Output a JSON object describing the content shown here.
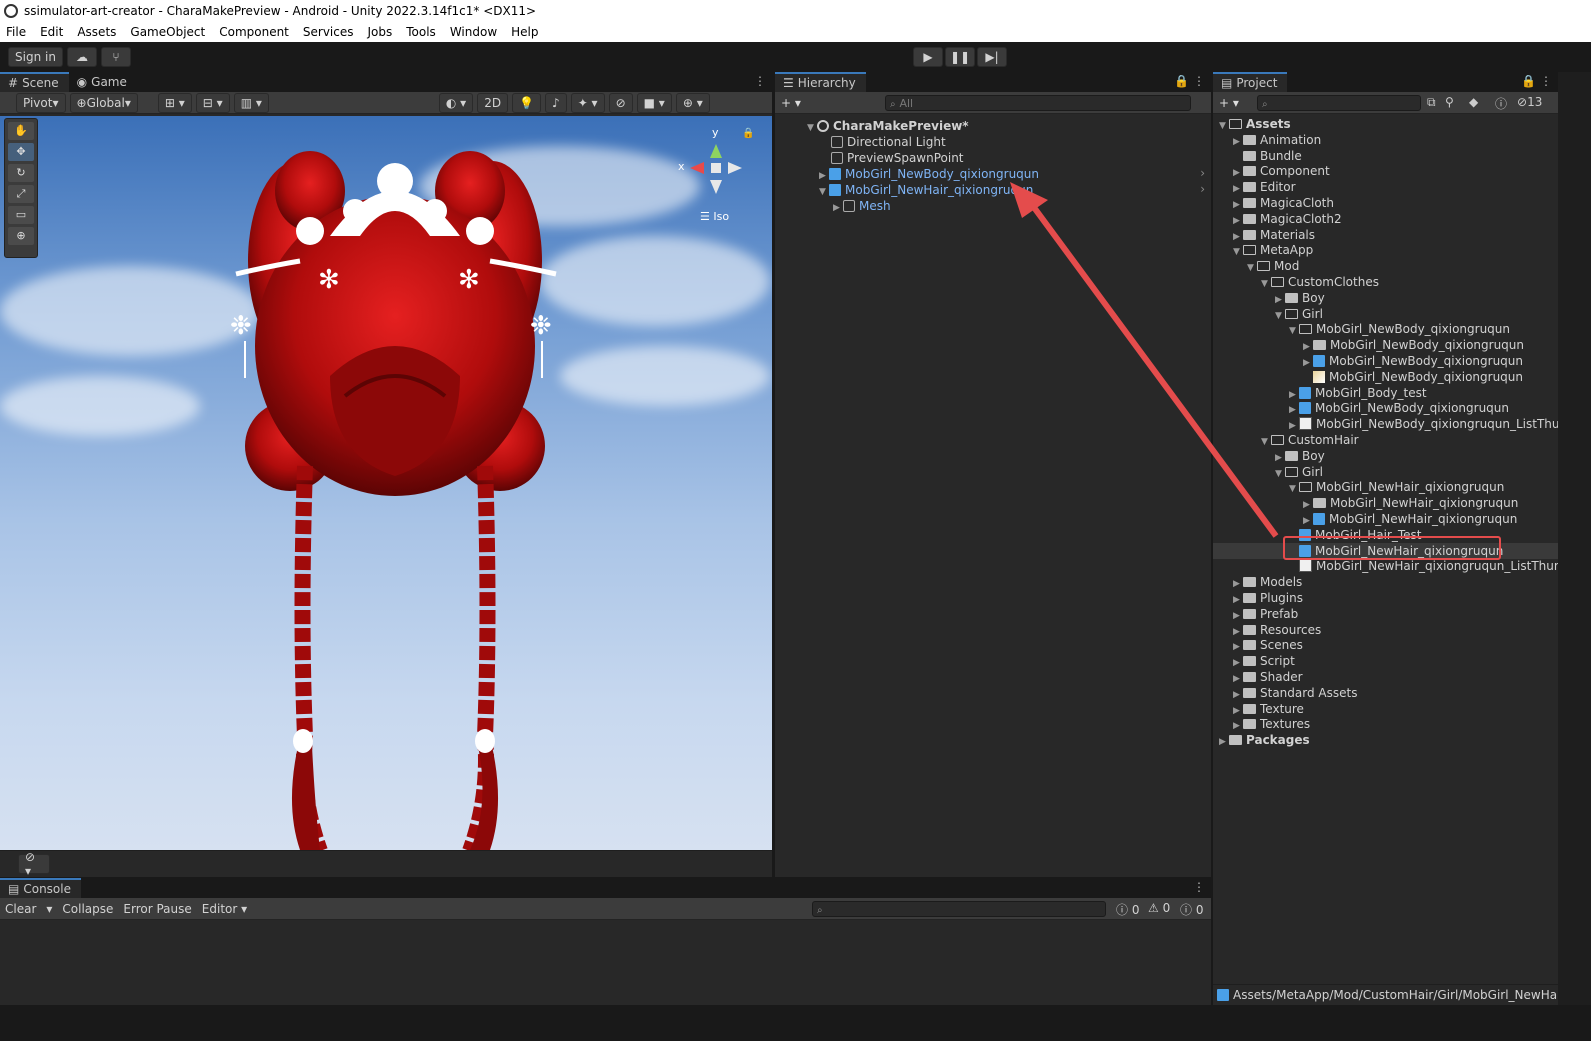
{
  "window": {
    "title": "ssimulator-art-creator - CharaMakePreview - Android - Unity 2022.3.14f1c1* <DX11>"
  },
  "menu": [
    "File",
    "Edit",
    "Assets",
    "GameObject",
    "Component",
    "Services",
    "Jobs",
    "Tools",
    "Window",
    "Help"
  ],
  "toolbar": {
    "sign_in": "Sign in"
  },
  "scene": {
    "tabs": [
      "Scene",
      "Game"
    ],
    "pivot": "Pivot",
    "global": "Global",
    "mode_2d": "2D",
    "gizmo_y": "y",
    "gizmo_x": "x",
    "iso": "Iso"
  },
  "hierarchy": {
    "tab": "Hierarchy",
    "search_placeholder": "All",
    "items": [
      {
        "label": "CharaMakePreview*",
        "kind": "scene"
      },
      {
        "label": "Directional Light",
        "kind": "go"
      },
      {
        "label": "PreviewSpawnPoint",
        "kind": "go"
      },
      {
        "label": "MobGirl_NewBody_qixiongruqun",
        "kind": "prefab"
      },
      {
        "label": "MobGirl_NewHair_qixiongruqun",
        "kind": "prefab"
      },
      {
        "label": "Mesh",
        "kind": "go"
      }
    ]
  },
  "project": {
    "tab": "Project",
    "hidden_count": "13",
    "tree": [
      {
        "label": "Assets",
        "depth": 0,
        "kind": "folder-open",
        "arrow": "down",
        "bold": true
      },
      {
        "label": "Animation",
        "depth": 1,
        "kind": "folder",
        "arrow": "right"
      },
      {
        "label": "Bundle",
        "depth": 1,
        "kind": "folder",
        "arrow": ""
      },
      {
        "label": "Component",
        "depth": 1,
        "kind": "folder",
        "arrow": "right"
      },
      {
        "label": "Editor",
        "depth": 1,
        "kind": "folder",
        "arrow": "right"
      },
      {
        "label": "MagicaCloth",
        "depth": 1,
        "kind": "folder",
        "arrow": "right"
      },
      {
        "label": "MagicaCloth2",
        "depth": 1,
        "kind": "folder",
        "arrow": "right"
      },
      {
        "label": "Materials",
        "depth": 1,
        "kind": "folder",
        "arrow": "right"
      },
      {
        "label": "MetaApp",
        "depth": 1,
        "kind": "folder-open",
        "arrow": "down"
      },
      {
        "label": "Mod",
        "depth": 2,
        "kind": "folder-open",
        "arrow": "down"
      },
      {
        "label": "CustomClothes",
        "depth": 3,
        "kind": "folder-open",
        "arrow": "down"
      },
      {
        "label": "Boy",
        "depth": 4,
        "kind": "folder",
        "arrow": "right"
      },
      {
        "label": "Girl",
        "depth": 4,
        "kind": "folder-open",
        "arrow": "down"
      },
      {
        "label": "MobGirl_NewBody_qixiongruqun",
        "depth": 5,
        "kind": "folder-open",
        "arrow": "down"
      },
      {
        "label": "MobGirl_NewBody_qixiongruqun",
        "depth": 6,
        "kind": "folder",
        "arrow": "right"
      },
      {
        "label": "MobGirl_NewBody_qixiongruqun",
        "depth": 6,
        "kind": "prefab",
        "arrow": "right"
      },
      {
        "label": "MobGirl_NewBody_qixiongruqun",
        "depth": 6,
        "kind": "image",
        "arrow": ""
      },
      {
        "label": "MobGirl_Body_test",
        "depth": 5,
        "kind": "prefab",
        "arrow": "right"
      },
      {
        "label": "MobGirl_NewBody_qixiongruqun",
        "depth": 5,
        "kind": "prefab",
        "arrow": "right"
      },
      {
        "label": "MobGirl_NewBody_qixiongruqun_ListThumb",
        "depth": 5,
        "kind": "thumb",
        "arrow": "right"
      },
      {
        "label": "CustomHair",
        "depth": 3,
        "kind": "folder-open",
        "arrow": "down"
      },
      {
        "label": "Boy",
        "depth": 4,
        "kind": "folder",
        "arrow": "right"
      },
      {
        "label": "Girl",
        "depth": 4,
        "kind": "folder-open",
        "arrow": "down"
      },
      {
        "label": "MobGirl_NewHair_qixiongruqun",
        "depth": 5,
        "kind": "folder-open",
        "arrow": "down"
      },
      {
        "label": "MobGirl_NewHair_qixiongruqun",
        "depth": 6,
        "kind": "folder",
        "arrow": "right"
      },
      {
        "label": "MobGirl_NewHair_qixiongruqun",
        "depth": 6,
        "kind": "prefab",
        "arrow": "right"
      },
      {
        "label": "MobGirl_Hair_Test",
        "depth": 5,
        "kind": "prefab",
        "arrow": ""
      },
      {
        "label": "MobGirl_NewHair_qixiongruqun",
        "depth": 5,
        "kind": "prefab",
        "arrow": "",
        "selected": true
      },
      {
        "label": "MobGirl_NewHair_qixiongruqun_ListThumb",
        "depth": 5,
        "kind": "thumb",
        "arrow": ""
      },
      {
        "label": "Models",
        "depth": 1,
        "kind": "folder",
        "arrow": "right"
      },
      {
        "label": "Plugins",
        "depth": 1,
        "kind": "folder",
        "arrow": "right"
      },
      {
        "label": "Prefab",
        "depth": 1,
        "kind": "folder",
        "arrow": "right"
      },
      {
        "label": "Resources",
        "depth": 1,
        "kind": "folder",
        "arrow": "right"
      },
      {
        "label": "Scenes",
        "depth": 1,
        "kind": "folder",
        "arrow": "right"
      },
      {
        "label": "Script",
        "depth": 1,
        "kind": "folder",
        "arrow": "right"
      },
      {
        "label": "Shader",
        "depth": 1,
        "kind": "folder",
        "arrow": "right"
      },
      {
        "label": "Standard Assets",
        "depth": 1,
        "kind": "folder",
        "arrow": "right"
      },
      {
        "label": "Texture",
        "depth": 1,
        "kind": "folder",
        "arrow": "right"
      },
      {
        "label": "Textures",
        "depth": 1,
        "kind": "folder",
        "arrow": "right"
      },
      {
        "label": "Packages",
        "depth": 0,
        "kind": "folder",
        "arrow": "right",
        "bold": true
      }
    ],
    "path": "Assets/MetaApp/Mod/CustomHair/Girl/MobGirl_NewHair_q"
  },
  "console": {
    "tab": "Console",
    "clear": "Clear",
    "collapse": "Collapse",
    "error_pause": "Error Pause",
    "editor": "Editor",
    "count_log": "0",
    "count_warn": "0",
    "count_error": "0"
  },
  "colors": {
    "accent": "#3a79bb",
    "highlight": "#e44c4c",
    "prefab": "#4aa0e8",
    "hair": "#b00c0c"
  }
}
